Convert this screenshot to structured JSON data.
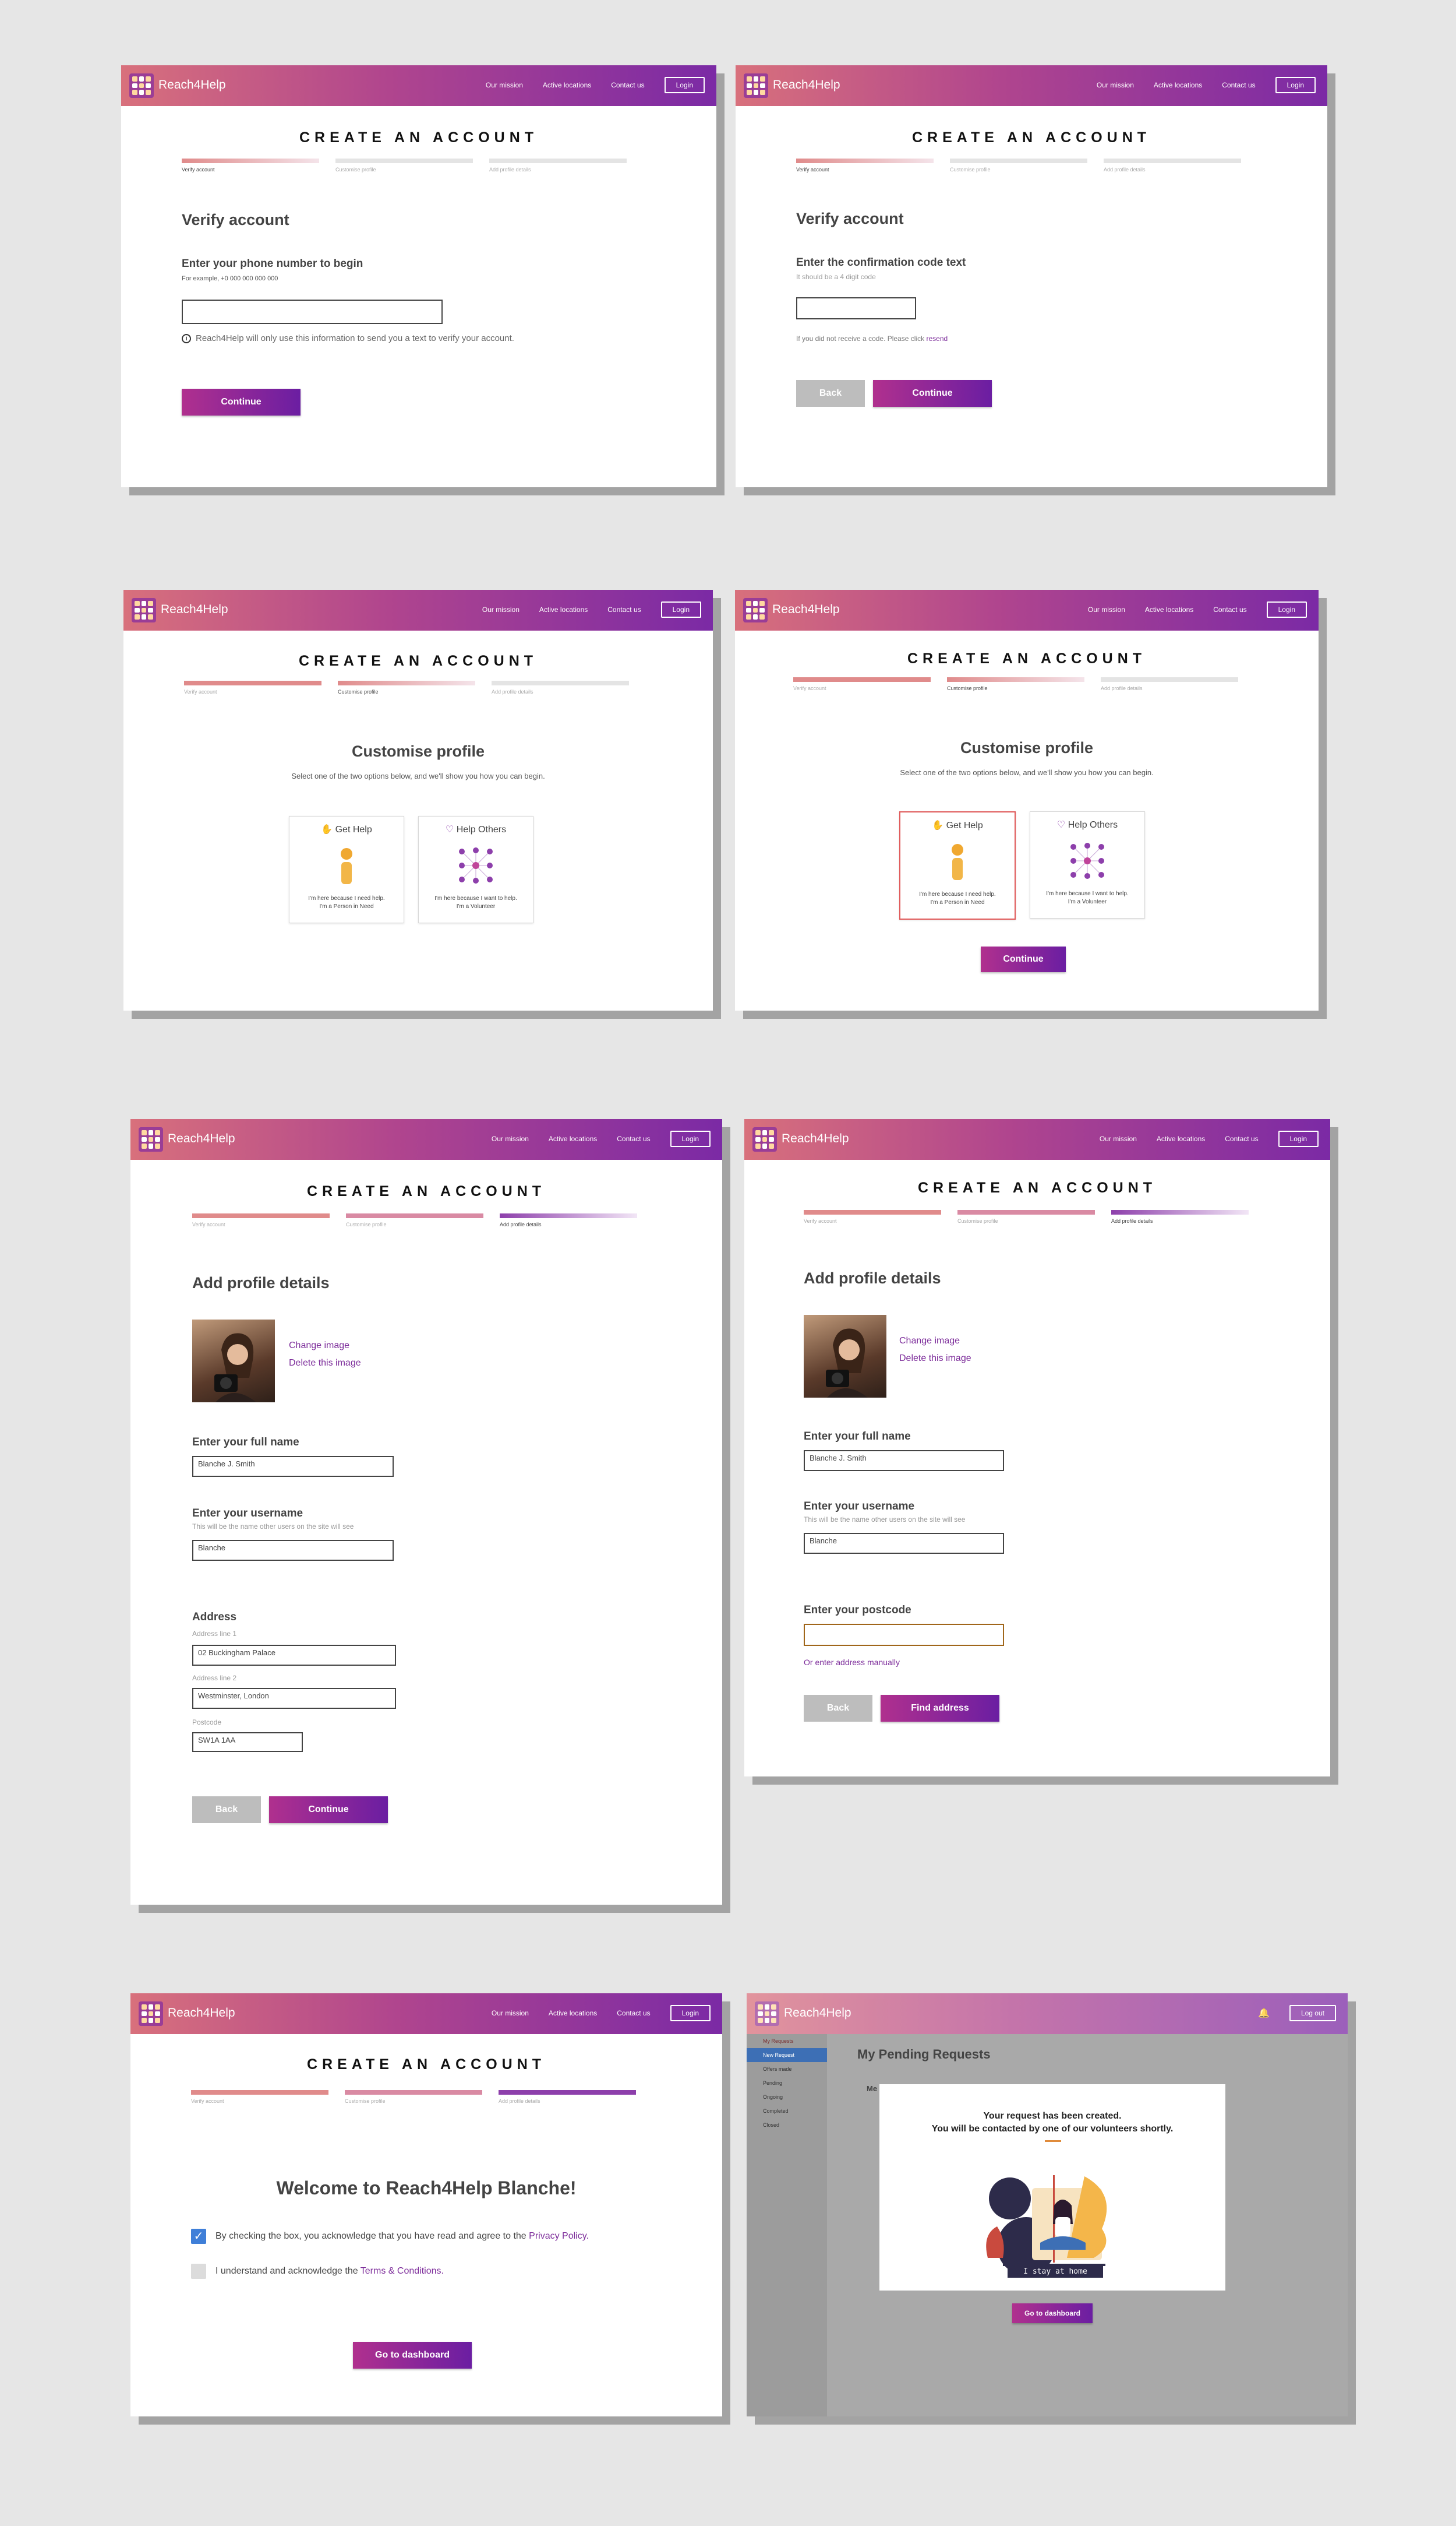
{
  "brand": "Reach4Help",
  "nav": {
    "mission": "Our mission",
    "locations": "Active locations",
    "contact": "Contact us",
    "login": "Login",
    "logout": "Log out"
  },
  "page_title": "CREATE AN ACCOUNT",
  "steps": [
    "Verify account",
    "Customise profile",
    "Add profile details"
  ],
  "verify_phone": {
    "heading": "Verify account",
    "label": "Enter your phone number to begin",
    "example": "For example, +0 000 000 000 000",
    "info": "Reach4Help will only use this information to send you a text to verify your account.",
    "continue": "Continue"
  },
  "verify_code": {
    "heading": "Verify account",
    "label": "Enter the confirmation code text",
    "hint": "It should be a 4 digit code",
    "resend_prefix": "If you did not receive a code. Please click",
    "resend_link": "resend",
    "back": "Back",
    "continue": "Continue"
  },
  "customise": {
    "heading": "Customise profile",
    "sub": "Select one of the two options below, and we'll show you how you can begin.",
    "get_help": "Get Help",
    "get_help_desc1": "I'm here because I need help.",
    "get_help_desc2": "I'm a Person in Need",
    "help_others": "Help Others",
    "help_others_desc1": "I'm here because I want to help.",
    "help_others_desc2": "I'm a Volunteer",
    "continue": "Continue"
  },
  "profile_address": {
    "heading": "Add profile details",
    "change_image": "Change image",
    "delete_image": "Delete this image",
    "name_label": "Enter your full name",
    "name_value": "Blanche J. Smith",
    "username_label": "Enter your username",
    "username_hint": "This will be the name other users on the site will see",
    "username_value": "Blanche",
    "address_label": "Address",
    "line1_label": "Address line 1",
    "line1_value": "02 Buckingham Palace",
    "line2_label": "Address line 2",
    "line2_value": "Westminster, London",
    "postcode_label": "Postcode",
    "postcode_value": "SW1A 1AA",
    "back": "Back",
    "continue": "Continue"
  },
  "profile_postcode": {
    "heading": "Add profile details",
    "change_image": "Change image",
    "delete_image": "Delete this image",
    "name_label": "Enter your full name",
    "name_value": "Blanche J. Smith",
    "username_label": "Enter your username",
    "username_hint": "This will be the name other users on the site will see",
    "username_value": "Blanche",
    "postcode_label": "Enter your postcode",
    "manual_link": "Or enter address manually",
    "back": "Back",
    "find": "Find address"
  },
  "welcome": {
    "heading": "Welcome to Reach4Help Blanche!",
    "privacy_text": "By checking the box, you acknowledge that you have read and agree to the",
    "privacy_link": "Privacy Policy.",
    "terms_text": "I understand and acknowledge the",
    "terms_link": "Terms & Conditions.",
    "privacy_checked": true,
    "terms_checked": false,
    "cta": "Go to dashboard"
  },
  "dashboard": {
    "page_heading": "My Pending Requests",
    "tab_partial": "Me",
    "sidebar": [
      "My Requests",
      "New Request",
      "Offers made",
      "Pending",
      "Ongoing",
      "Completed",
      "Closed"
    ],
    "modal_line1": "Your request has been created.",
    "modal_line2": "You will be contacted by one of our volunteers shortly.",
    "illustration_caption": "I stay at home",
    "cta": "Go to dashboard"
  },
  "colors": {
    "nav_start": "#d8707c",
    "nav_end": "#7b2aa5",
    "accent": "#7c2c9a",
    "step_done": "#e08b8b"
  }
}
